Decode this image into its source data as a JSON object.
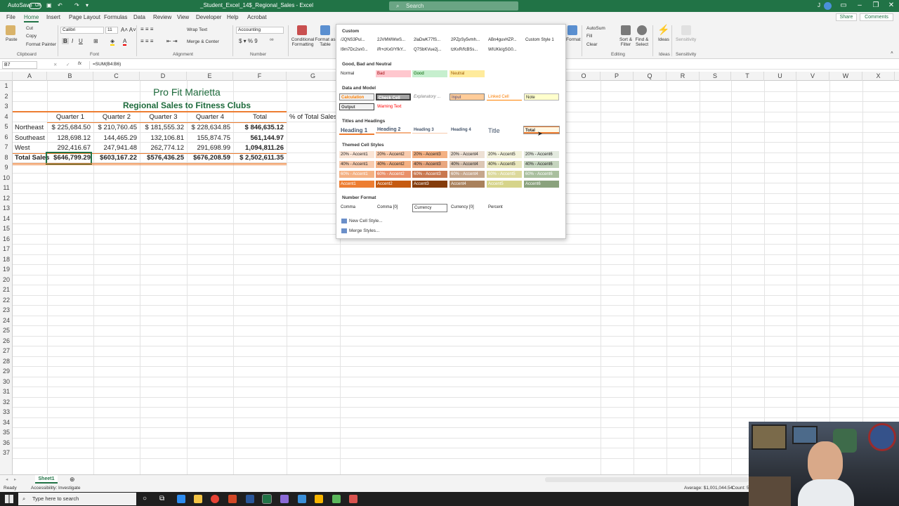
{
  "titlebar": {
    "autosave_label": "AutoSave",
    "autosave_state": "Off",
    "file_title": "_Student_Excel_14$_Regional_Sales - Excel",
    "search_placeholder": "Search",
    "share_label": "Share",
    "comments_label": "Comments"
  },
  "menu": {
    "tabs": [
      "File",
      "Home",
      "Insert",
      "Page Layout",
      "Formulas",
      "Data",
      "Review",
      "View",
      "Developer",
      "Help",
      "Acrobat"
    ],
    "active": "Home"
  },
  "ribbon": {
    "paste": "Paste",
    "cut": "Cut",
    "copy": "Copy",
    "format_painter": "Format Painter",
    "clipboard_group": "Clipboard",
    "font_name": "Calibri",
    "font_size": "11",
    "font_group": "Font",
    "wrap_text": "Wrap Text",
    "merge_center": "Merge & Center",
    "alignment_group": "Alignment",
    "number_format": "Accounting",
    "number_group": "Number",
    "conditional_formatting": "Conditional Formatting",
    "format_as_table": "Format as Table",
    "format": "Format",
    "autosum": "AutoSum",
    "fill": "Fill",
    "clear": "Clear",
    "sort_filter": "Sort & Filter",
    "find_select": "Find & Select",
    "editing_group": "Editing",
    "ideas": "Ideas",
    "ideas_group": "Ideas",
    "sensitivity": "Sensitivity",
    "sensitivity_group": "Sensitivity"
  },
  "formula_bar": {
    "name_box": "B7",
    "formula": "=SUM(B4:B6)"
  },
  "columns": [
    "A",
    "B",
    "C",
    "D",
    "E",
    "F",
    "G",
    "O",
    "P",
    "Q",
    "R",
    "S",
    "T",
    "U",
    "V",
    "W",
    "X"
  ],
  "rows": [
    "1",
    "2",
    "3",
    "4",
    "5",
    "6",
    "7",
    "8",
    "9",
    "10",
    "11",
    "12",
    "13",
    "14",
    "15",
    "16",
    "17",
    "18",
    "19",
    "20",
    "21",
    "22",
    "23",
    "24",
    "25",
    "26",
    "27",
    "28",
    "29",
    "30",
    "31",
    "32",
    "33",
    "34",
    "35",
    "36",
    "37"
  ],
  "sheet": {
    "title": "Pro Fit Marietta",
    "subtitle": "Regional Sales to Fitness Clubs",
    "headers": [
      "Quarter 1",
      "Quarter 2",
      "Quarter 3",
      "Quarter 4",
      "Total",
      "% of Total Sales"
    ],
    "data_rows": [
      {
        "label": "Northeast",
        "q1": "$ 225,684.50",
        "q2": "$ 210,760.45",
        "q3": "$ 181,555.32",
        "q4": "$ 228,634.85",
        "total": "$    846,635.12"
      },
      {
        "label": "Southeast",
        "q1": "128,698.12",
        "q2": "144,465.29",
        "q3": "132,106.81",
        "q4": "155,874.75",
        "total": "561,144.97"
      },
      {
        "label": "West",
        "q1": "292,416.67",
        "q2": "247,941.48",
        "q3": "262,774.12",
        "q4": "291,698.99",
        "total": "1,094,811.26"
      }
    ],
    "total_row": {
      "label": "Total Sales",
      "q1": "$646,799.29",
      "q2": "$603,167.22",
      "q3": "$576,436.25",
      "q4": "$676,208.59",
      "total": "$ 2,502,611.35"
    }
  },
  "gallery": {
    "custom_header": "Custom",
    "custom_styles": [
      "/JQNS3Pul...",
      "2JVMWWwS...",
      "2laDwK77fS...",
      "2PZpSy5vmh...",
      "ABn4guvHZP...",
      "Custom Style 1",
      "I9m7Dc2sn0...",
      "iR+cKx0/YfkY...",
      "Q7SbKVue2j...",
      "tzKxR/fcBSs...",
      "WIUKk/gSG0..."
    ],
    "good_bad_header": "Good, Bad and Neutral",
    "good_bad": [
      "Normal",
      "Bad",
      "Good",
      "Neutral"
    ],
    "data_model_header": "Data and Model",
    "data_model_row1": [
      "Calculation",
      "Check Cell",
      "Explanatory ...",
      "Input",
      "Linked Cell",
      "Note"
    ],
    "data_model_row2": [
      "Output",
      "Warning Text"
    ],
    "titles_header": "Titles and Headings",
    "titles": [
      "Heading 1",
      "Heading 2",
      "Heading 3",
      "Heading 4",
      "Title",
      "Total"
    ],
    "themed_header": "Themed Cell Styles",
    "themed_20": [
      "20% - Accent1",
      "20% - Accent2",
      "20% - Accent3",
      "20% - Accent4",
      "20% - Accent5",
      "20% - Accent6"
    ],
    "themed_40": [
      "40% - Accent1",
      "40% - Accent2",
      "40% - Accent3",
      "40% - Accent4",
      "40% - Accent5",
      "40% - Accent6"
    ],
    "themed_60": [
      "60% - Accent1",
      "60% - Accent2",
      "60% - Accent3",
      "60% - Accent4",
      "60% - Accent5",
      "60% - Accent6"
    ],
    "accents": [
      "Accent1",
      "Accent2",
      "Accent3",
      "Accent4",
      "Accent5",
      "Accent6"
    ],
    "number_header": "Number Format",
    "number_formats": [
      "Comma",
      "Comma [0]",
      "Currency",
      "Currency [0]",
      "Percent"
    ],
    "new_cell_style": "New Cell Style...",
    "merge_styles": "Merge Styles..."
  },
  "colors": {
    "excel_green": "#217346",
    "title_green": "#1e6b3c",
    "accent1": "#ed7d31",
    "accent2": "#c55a11",
    "accent3": "#843c0c",
    "accent4": "#a9815c",
    "accent5": "#d6d48a",
    "accent6": "#8aa27d"
  },
  "sheet_tabs": {
    "active": "Sheet1"
  },
  "status": {
    "ready": "Ready",
    "accessibility": "Accessibility: Investigate",
    "average": "Average: $1,001,044.54",
    "count": "Count: 5"
  },
  "taskbar": {
    "search_placeholder": "Type here to search"
  }
}
